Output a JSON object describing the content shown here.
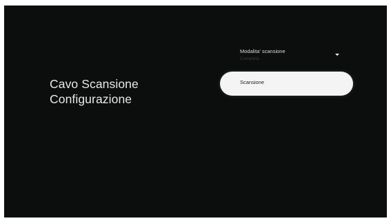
{
  "page": {
    "title_line1": "Cavo Scansione",
    "title_line2": "Configurazione"
  },
  "scan_mode": {
    "label": "Modalita' scansione",
    "value": "Completa",
    "icon": "caret-down-icon"
  },
  "scan_button": {
    "label": "Scansione"
  },
  "colors": {
    "background": "#0c0d0d",
    "focused_button": "#f4f4f4",
    "text": "#e9e9e9"
  }
}
